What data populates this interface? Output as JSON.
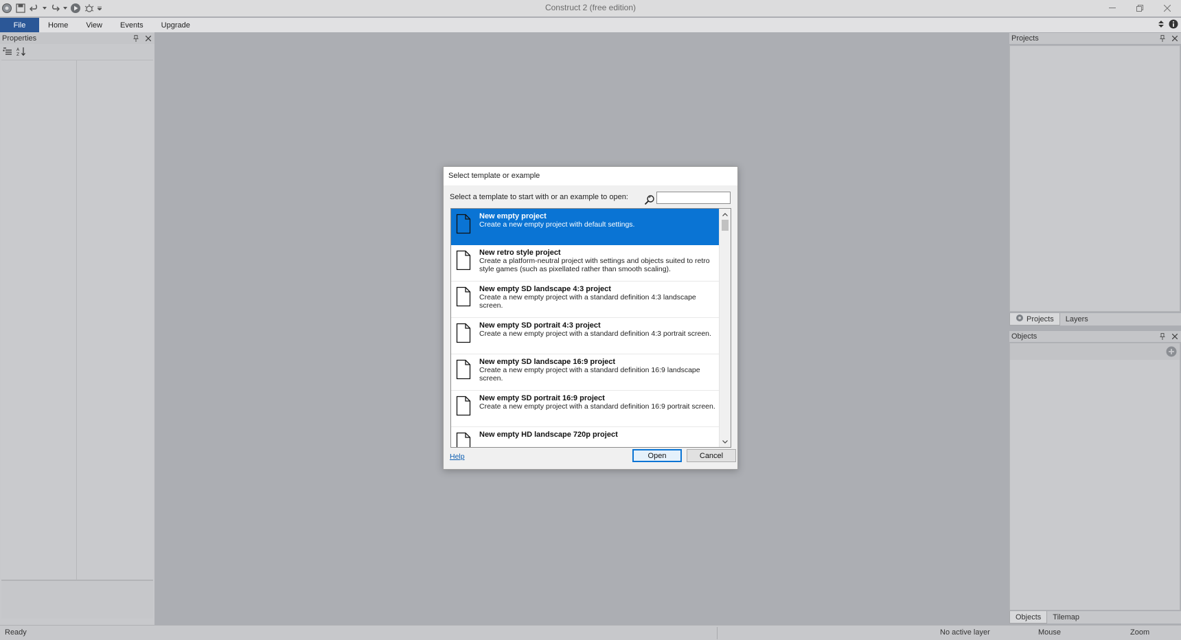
{
  "window": {
    "title": "Construct 2  (free edition)"
  },
  "quick_access": {
    "icons": [
      "app-logo-icon",
      "save-icon",
      "undo-icon",
      "redo-icon",
      "run-layout-icon",
      "debug-icon",
      "customize-qat-icon"
    ]
  },
  "ribbon": {
    "tabs": [
      {
        "label": "File"
      },
      {
        "label": "Home"
      },
      {
        "label": "View"
      },
      {
        "label": "Events"
      },
      {
        "label": "Upgrade"
      }
    ]
  },
  "properties_panel": {
    "title": "Properties"
  },
  "projects_panel": {
    "title": "Projects",
    "tabs": [
      {
        "label": "Projects"
      },
      {
        "label": "Layers"
      }
    ]
  },
  "objects_panel": {
    "title": "Objects",
    "tabs": [
      {
        "label": "Objects"
      },
      {
        "label": "Tilemap"
      }
    ]
  },
  "statusbar": {
    "status": "Ready",
    "layer": "No active layer",
    "mouse": "Mouse",
    "zoom": "Zoom"
  },
  "dialog": {
    "title": "Select template or example",
    "prompt": "Select a template to start with or an example to open:",
    "search": {
      "value": "",
      "placeholder": ""
    },
    "items": [
      {
        "title": "New empty project",
        "desc": "Create a new empty project with default settings.",
        "selected": true
      },
      {
        "title": "New retro style project",
        "desc": "Create a platform-neutral project with settings and objects suited to retro style games (such as pixellated rather than smooth scaling)."
      },
      {
        "title": "New empty SD landscape 4:3 project",
        "desc": "Create a new empty project with a standard definition 4:3 landscape screen."
      },
      {
        "title": "New empty SD portrait 4:3 project",
        "desc": "Create a new empty project with a standard definition 4:3 portrait screen."
      },
      {
        "title": "New empty SD landscape 16:9 project",
        "desc": "Create a new empty project with a standard definition 16:9 landscape screen."
      },
      {
        "title": "New empty SD portrait 16:9 project",
        "desc": "Create a new empty project with a standard definition 16:9 portrait screen."
      },
      {
        "title": "New empty HD landscape 720p project",
        "desc": ""
      }
    ],
    "help_label": "Help",
    "open_label": "Open",
    "cancel_label": "Cancel",
    "accent_color": "#0a74d4"
  }
}
